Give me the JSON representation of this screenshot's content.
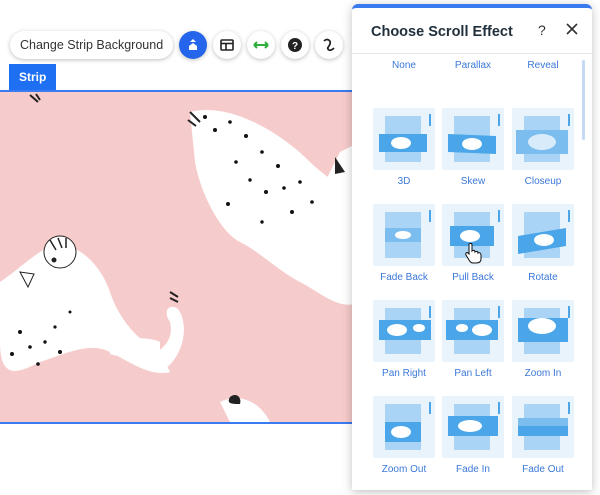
{
  "toolbar": {
    "change_background_label": "Change Strip Background",
    "icons": [
      "scroll-effect-icon",
      "layout-icon",
      "stretch-icon",
      "help-icon",
      "animation-icon"
    ]
  },
  "strip": {
    "tag_label": "Strip"
  },
  "panel": {
    "title": "Choose Scroll Effect",
    "help_label": "?",
    "effects": [
      {
        "label": "None"
      },
      {
        "label": "Parallax"
      },
      {
        "label": "Reveal"
      },
      {
        "label": "3D"
      },
      {
        "label": "Skew"
      },
      {
        "label": "Closeup"
      },
      {
        "label": "Fade Back"
      },
      {
        "label": "Pull Back"
      },
      {
        "label": "Rotate"
      },
      {
        "label": "Pan Right"
      },
      {
        "label": "Pan Left"
      },
      {
        "label": "Zoom In"
      },
      {
        "label": "Zoom Out"
      },
      {
        "label": "Fade In"
      },
      {
        "label": "Fade Out"
      }
    ]
  },
  "colors": {
    "accent": "#1f6ff2",
    "panel_accent": "#3a7bf0",
    "strip_background": "#f6cbcb",
    "label_color": "#3b78d8",
    "thumb_bg": "#e8f3fc"
  }
}
